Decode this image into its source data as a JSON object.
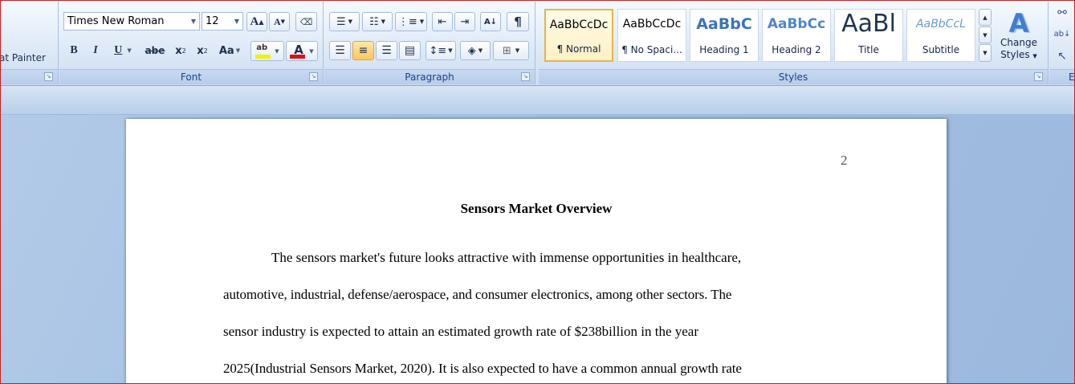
{
  "clipboard": {
    "format_painter_label": "at Painter"
  },
  "font": {
    "family": "Times New Roman",
    "size": "12",
    "group_label": "Font",
    "grow_label": "A",
    "shrink_label": "A",
    "bold_label": "B",
    "italic_label": "I",
    "underline_label": "U",
    "strike_label": "abe",
    "subscript_label": "x",
    "superscript_label": "x",
    "change_case_label": "Aa",
    "highlight_label": "ab",
    "color_label": "A",
    "highlight_color": "#f2f200",
    "font_color": "#e01010"
  },
  "paragraph": {
    "group_label": "Paragraph",
    "pilcrow": "¶"
  },
  "styles": {
    "group_label": "Styles",
    "items": [
      {
        "sample": "AaBbCcDc",
        "name": "¶ Normal"
      },
      {
        "sample": "AaBbCcDc",
        "name": "¶ No Spaci..."
      },
      {
        "sample": "AaBbC",
        "name": "Heading 1"
      },
      {
        "sample": "AaBbCc",
        "name": "Heading 2"
      },
      {
        "sample": "AaBl",
        "name": "Title"
      },
      {
        "sample": "AaBbCcL",
        "name": "Subtitle"
      }
    ],
    "change_styles_line1": "Change",
    "change_styles_line2": "Styles",
    "heading_color": "#3b73b9"
  },
  "editing": {
    "group_label": "E"
  },
  "document": {
    "page_number": "2",
    "title": "Sensors Market Overview",
    "lines": [
      "The sensors market's future looks attractive with immense opportunities in healthcare,",
      "automotive, industrial, defense/aerospace, and consumer electronics, among other sectors. The",
      "sensor industry is expected to attain an estimated growth rate of $238billion in the year",
      "2025(Industrial Sensors Market, 2020). It is also expected to have a common annual growth rate"
    ]
  }
}
